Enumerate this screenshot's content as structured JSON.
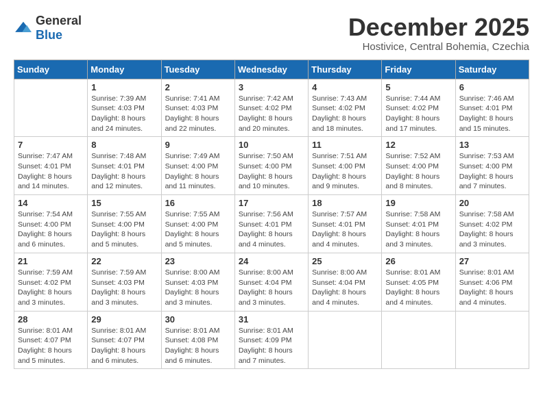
{
  "logo": {
    "general": "General",
    "blue": "Blue"
  },
  "title": "December 2025",
  "subtitle": "Hostivice, Central Bohemia, Czechia",
  "days_of_week": [
    "Sunday",
    "Monday",
    "Tuesday",
    "Wednesday",
    "Thursday",
    "Friday",
    "Saturday"
  ],
  "weeks": [
    [
      {
        "day": "",
        "sunrise": "",
        "sunset": "",
        "daylight": ""
      },
      {
        "day": "1",
        "sunrise": "Sunrise: 7:39 AM",
        "sunset": "Sunset: 4:03 PM",
        "daylight": "Daylight: 8 hours and 24 minutes."
      },
      {
        "day": "2",
        "sunrise": "Sunrise: 7:41 AM",
        "sunset": "Sunset: 4:03 PM",
        "daylight": "Daylight: 8 hours and 22 minutes."
      },
      {
        "day": "3",
        "sunrise": "Sunrise: 7:42 AM",
        "sunset": "Sunset: 4:02 PM",
        "daylight": "Daylight: 8 hours and 20 minutes."
      },
      {
        "day": "4",
        "sunrise": "Sunrise: 7:43 AM",
        "sunset": "Sunset: 4:02 PM",
        "daylight": "Daylight: 8 hours and 18 minutes."
      },
      {
        "day": "5",
        "sunrise": "Sunrise: 7:44 AM",
        "sunset": "Sunset: 4:02 PM",
        "daylight": "Daylight: 8 hours and 17 minutes."
      },
      {
        "day": "6",
        "sunrise": "Sunrise: 7:46 AM",
        "sunset": "Sunset: 4:01 PM",
        "daylight": "Daylight: 8 hours and 15 minutes."
      }
    ],
    [
      {
        "day": "7",
        "sunrise": "Sunrise: 7:47 AM",
        "sunset": "Sunset: 4:01 PM",
        "daylight": "Daylight: 8 hours and 14 minutes."
      },
      {
        "day": "8",
        "sunrise": "Sunrise: 7:48 AM",
        "sunset": "Sunset: 4:01 PM",
        "daylight": "Daylight: 8 hours and 12 minutes."
      },
      {
        "day": "9",
        "sunrise": "Sunrise: 7:49 AM",
        "sunset": "Sunset: 4:00 PM",
        "daylight": "Daylight: 8 hours and 11 minutes."
      },
      {
        "day": "10",
        "sunrise": "Sunrise: 7:50 AM",
        "sunset": "Sunset: 4:00 PM",
        "daylight": "Daylight: 8 hours and 10 minutes."
      },
      {
        "day": "11",
        "sunrise": "Sunrise: 7:51 AM",
        "sunset": "Sunset: 4:00 PM",
        "daylight": "Daylight: 8 hours and 9 minutes."
      },
      {
        "day": "12",
        "sunrise": "Sunrise: 7:52 AM",
        "sunset": "Sunset: 4:00 PM",
        "daylight": "Daylight: 8 hours and 8 minutes."
      },
      {
        "day": "13",
        "sunrise": "Sunrise: 7:53 AM",
        "sunset": "Sunset: 4:00 PM",
        "daylight": "Daylight: 8 hours and 7 minutes."
      }
    ],
    [
      {
        "day": "14",
        "sunrise": "Sunrise: 7:54 AM",
        "sunset": "Sunset: 4:00 PM",
        "daylight": "Daylight: 8 hours and 6 minutes."
      },
      {
        "day": "15",
        "sunrise": "Sunrise: 7:55 AM",
        "sunset": "Sunset: 4:00 PM",
        "daylight": "Daylight: 8 hours and 5 minutes."
      },
      {
        "day": "16",
        "sunrise": "Sunrise: 7:55 AM",
        "sunset": "Sunset: 4:00 PM",
        "daylight": "Daylight: 8 hours and 5 minutes."
      },
      {
        "day": "17",
        "sunrise": "Sunrise: 7:56 AM",
        "sunset": "Sunset: 4:01 PM",
        "daylight": "Daylight: 8 hours and 4 minutes."
      },
      {
        "day": "18",
        "sunrise": "Sunrise: 7:57 AM",
        "sunset": "Sunset: 4:01 PM",
        "daylight": "Daylight: 8 hours and 4 minutes."
      },
      {
        "day": "19",
        "sunrise": "Sunrise: 7:58 AM",
        "sunset": "Sunset: 4:01 PM",
        "daylight": "Daylight: 8 hours and 3 minutes."
      },
      {
        "day": "20",
        "sunrise": "Sunrise: 7:58 AM",
        "sunset": "Sunset: 4:02 PM",
        "daylight": "Daylight: 8 hours and 3 minutes."
      }
    ],
    [
      {
        "day": "21",
        "sunrise": "Sunrise: 7:59 AM",
        "sunset": "Sunset: 4:02 PM",
        "daylight": "Daylight: 8 hours and 3 minutes."
      },
      {
        "day": "22",
        "sunrise": "Sunrise: 7:59 AM",
        "sunset": "Sunset: 4:03 PM",
        "daylight": "Daylight: 8 hours and 3 minutes."
      },
      {
        "day": "23",
        "sunrise": "Sunrise: 8:00 AM",
        "sunset": "Sunset: 4:03 PM",
        "daylight": "Daylight: 8 hours and 3 minutes."
      },
      {
        "day": "24",
        "sunrise": "Sunrise: 8:00 AM",
        "sunset": "Sunset: 4:04 PM",
        "daylight": "Daylight: 8 hours and 3 minutes."
      },
      {
        "day": "25",
        "sunrise": "Sunrise: 8:00 AM",
        "sunset": "Sunset: 4:04 PM",
        "daylight": "Daylight: 8 hours and 4 minutes."
      },
      {
        "day": "26",
        "sunrise": "Sunrise: 8:01 AM",
        "sunset": "Sunset: 4:05 PM",
        "daylight": "Daylight: 8 hours and 4 minutes."
      },
      {
        "day": "27",
        "sunrise": "Sunrise: 8:01 AM",
        "sunset": "Sunset: 4:06 PM",
        "daylight": "Daylight: 8 hours and 4 minutes."
      }
    ],
    [
      {
        "day": "28",
        "sunrise": "Sunrise: 8:01 AM",
        "sunset": "Sunset: 4:07 PM",
        "daylight": "Daylight: 8 hours and 5 minutes."
      },
      {
        "day": "29",
        "sunrise": "Sunrise: 8:01 AM",
        "sunset": "Sunset: 4:07 PM",
        "daylight": "Daylight: 8 hours and 6 minutes."
      },
      {
        "day": "30",
        "sunrise": "Sunrise: 8:01 AM",
        "sunset": "Sunset: 4:08 PM",
        "daylight": "Daylight: 8 hours and 6 minutes."
      },
      {
        "day": "31",
        "sunrise": "Sunrise: 8:01 AM",
        "sunset": "Sunset: 4:09 PM",
        "daylight": "Daylight: 8 hours and 7 minutes."
      },
      {
        "day": "",
        "sunrise": "",
        "sunset": "",
        "daylight": ""
      },
      {
        "day": "",
        "sunrise": "",
        "sunset": "",
        "daylight": ""
      },
      {
        "day": "",
        "sunrise": "",
        "sunset": "",
        "daylight": ""
      }
    ]
  ]
}
